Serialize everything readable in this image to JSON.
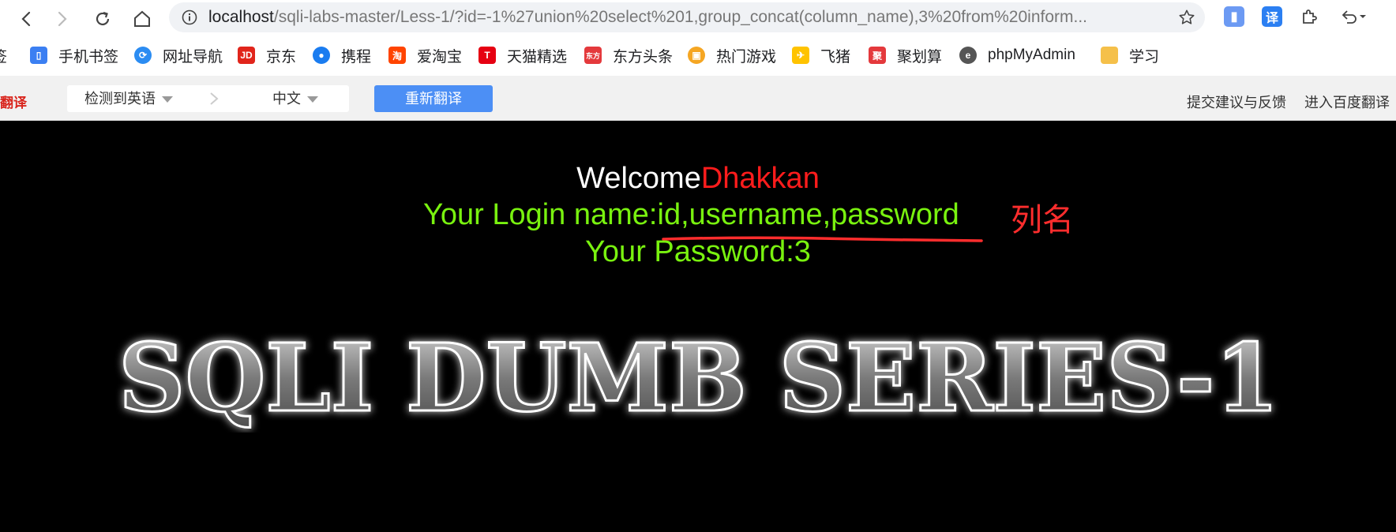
{
  "browser": {
    "url_host": "localhost",
    "url_path": "/sqli-labs-master/Less-1/?id=-1%27union%20select%201,group_concat(column_name),3%20from%20inform..."
  },
  "bookmarks": [
    {
      "label": "签",
      "icon": "bookmark-partial"
    },
    {
      "label": "手机书签",
      "icon": "phone-icon",
      "color": "#3b7ff2"
    },
    {
      "label": "网址导航",
      "icon": "compass-icon",
      "color": "#2b8cf2"
    },
    {
      "label": "京东",
      "icon": "jd-icon",
      "color": "#e1251b"
    },
    {
      "label": "携程",
      "icon": "ctrip-icon",
      "color": "#1a7cf0"
    },
    {
      "label": "爱淘宝",
      "icon": "taobao-icon",
      "color": "#ff4400"
    },
    {
      "label": "天猫精选",
      "icon": "tmall-icon",
      "color": "#e60012"
    },
    {
      "label": "东方头条",
      "icon": "dongfang-icon",
      "color": "#e4393c"
    },
    {
      "label": "热门游戏",
      "icon": "game-icon",
      "color": "#f5a623"
    },
    {
      "label": "飞猪",
      "icon": "fliggy-icon",
      "color": "#ffc300"
    },
    {
      "label": "聚划算",
      "icon": "juhuasuan-icon",
      "color": "#e4393c"
    },
    {
      "label": "phpMyAdmin",
      "icon": "phpmyadmin-icon",
      "color": "#555555"
    },
    {
      "label": "学习",
      "icon": "folder-icon",
      "color": "#f5c04a"
    }
  ],
  "translate_bar": {
    "logo": "翻译",
    "source_lang": "检测到英语",
    "target_lang": "中文",
    "retranslate_button": "重新翻译",
    "feedback_link": "提交建议与反馈",
    "baidu_link": "进入百度翻译"
  },
  "page": {
    "welcome_prefix": "Welcome",
    "welcome_name": "Dhakkan",
    "login_label": "Your Login name:",
    "login_value": "id,username,password",
    "password_line": "Your Password:3",
    "annotation": "列名",
    "banner_text": "SQLI DUMB SERIES-1"
  },
  "colors": {
    "accent_green": "#79f20f",
    "accent_red": "#ff1c1c",
    "retranslate_blue": "#4c8ff5"
  }
}
